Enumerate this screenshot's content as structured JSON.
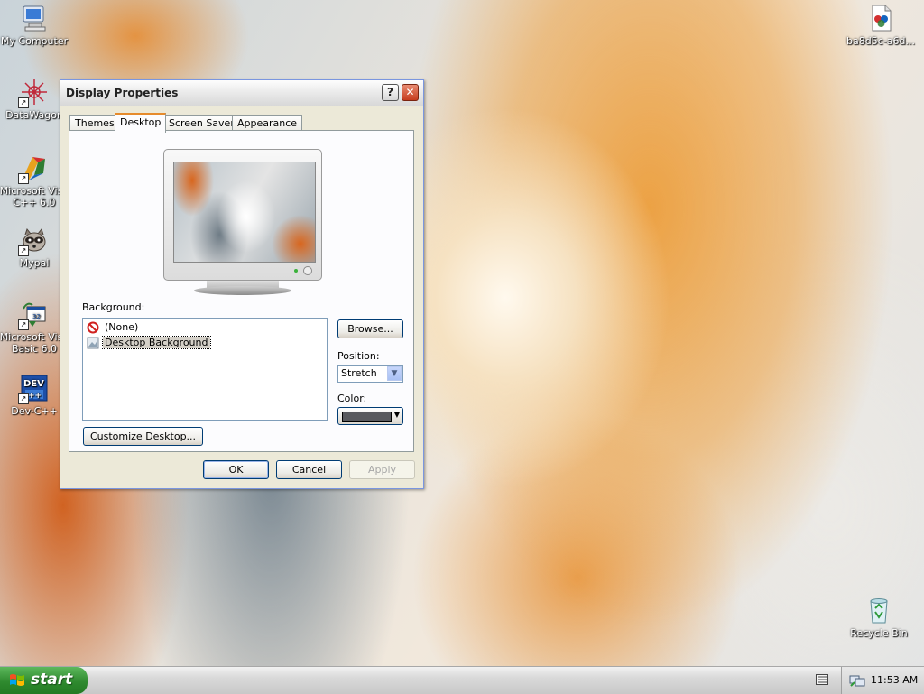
{
  "desktop": {
    "icons": [
      {
        "label": "My Computer"
      },
      {
        "label": "DataWagon"
      },
      {
        "label": "Microsoft Visu C++ 6.0"
      },
      {
        "label": "Mypal"
      },
      {
        "label": "Microsoft Visu Basic 6.0"
      },
      {
        "label": "Dev-C++"
      },
      {
        "label": "ba8d5c-a6d..."
      },
      {
        "label": "Recycle Bin"
      }
    ]
  },
  "dialog": {
    "title": "Display Properties",
    "help_label": "?",
    "close_label": "✕",
    "tabs": [
      {
        "label": "Themes"
      },
      {
        "label": "Desktop"
      },
      {
        "label": "Screen Saver"
      },
      {
        "label": "Appearance"
      }
    ],
    "active_tab": "Desktop",
    "background_label": "Background:",
    "background_items": [
      {
        "label": "(None)",
        "icon": "no-symbol-icon"
      },
      {
        "label": "Desktop Background",
        "icon": "image-file-icon"
      }
    ],
    "browse_label": "Browse...",
    "position_label": "Position:",
    "position_value": "Stretch",
    "color_label": "Color:",
    "color_value": "#58595d",
    "customize_label": "Customize Desktop...",
    "ok_label": "OK",
    "cancel_label": "Cancel",
    "apply_label": "Apply"
  },
  "taskbar": {
    "start_label": "start",
    "clock": "11:53 AM"
  }
}
